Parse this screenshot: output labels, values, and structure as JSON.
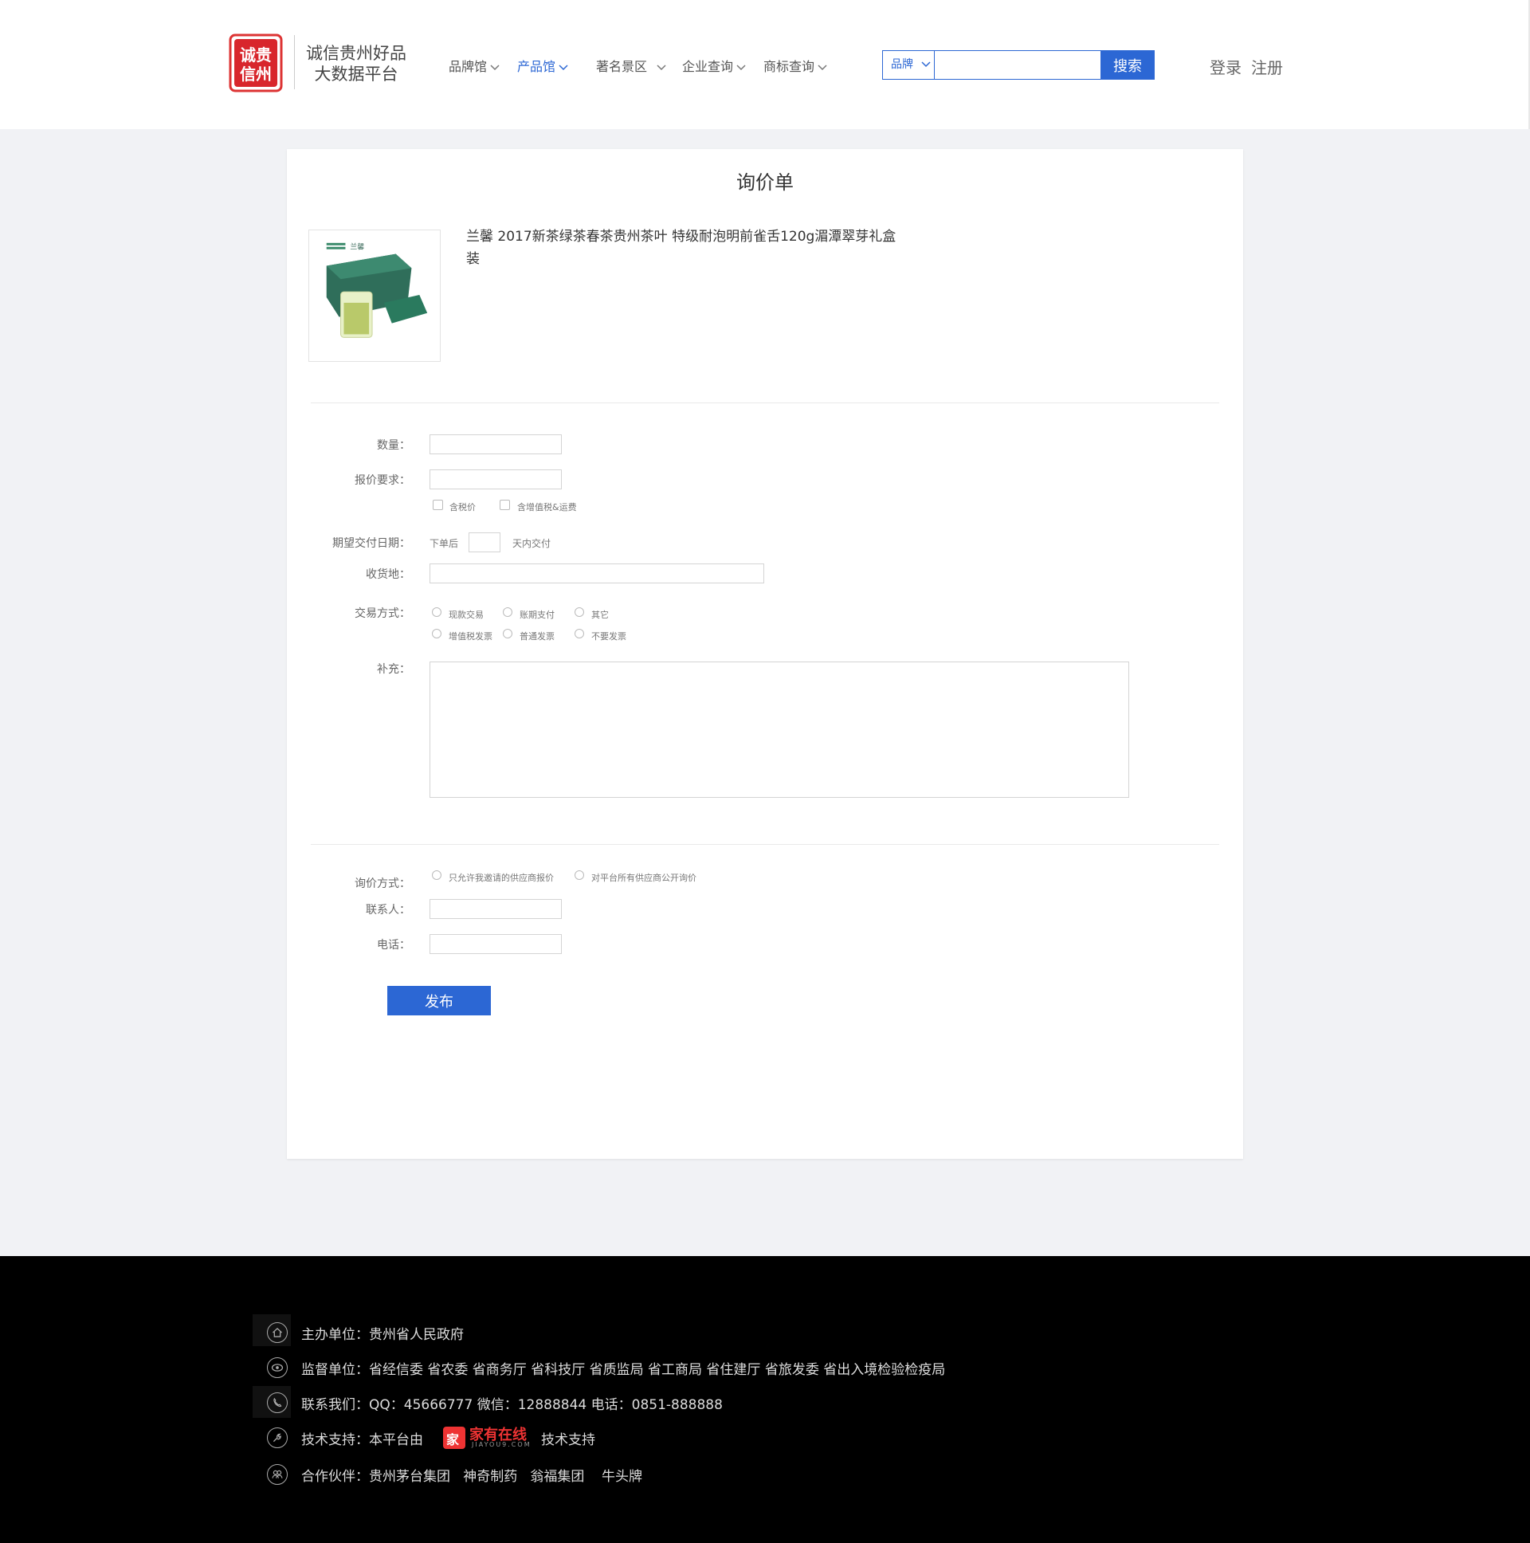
{
  "header": {
    "logo_line1": "诚信贵州好品",
    "logo_line2": "大数据平台",
    "nav": [
      {
        "label": "品牌馆",
        "active": false
      },
      {
        "label": "产品馆",
        "active": true
      },
      {
        "label": "著名景区",
        "active": false
      },
      {
        "label": "企业查询",
        "active": false
      },
      {
        "label": "商标查询",
        "active": false
      }
    ],
    "search": {
      "category": "品牌",
      "value": "",
      "button": "搜索"
    },
    "login": "登录",
    "register": "注册",
    "accent_color": "#2c67d4"
  },
  "form": {
    "title": "询价单",
    "product_name": "兰馨 2017新茶绿茶春茶贵州茶叶 特级耐泡明前雀舌120g湄潭翠芽礼盒装",
    "product_image_icon": "tea-gift-box-image",
    "quantity_label": "数量：",
    "quote_req_label": "报价要求：",
    "tax_included": "含税价",
    "tax_shipping_included": "含增值税&运费",
    "delivery_label": "期望交付日期：",
    "delivery_prefix": "下单后",
    "delivery_suffix": "天内交付",
    "address_label": "收货地：",
    "trade_label": "交易方式：",
    "trade_options": [
      "现款交易",
      "账期支付",
      "其它"
    ],
    "invoice_options": [
      "增值税发票",
      "普通发票",
      "不要发票"
    ],
    "extra_label": "补充：",
    "inquiry_label": "询价方式：",
    "inquiry_options": [
      "只允许我邀请的供应商报价",
      "对平台所有供应商公开询价"
    ],
    "contact_label": "联系人：",
    "phone_label": "电话：",
    "publish": "发布"
  },
  "footer": {
    "host": "主办单位：贵州省人民政府",
    "supervisor": "监督单位：省经信委 省农委 省商务厅 省科技厅 省质监局 省工商局 省住建厅 省旅发委 省出入境检验检疫局",
    "contact": "联系我们：QQ：45666777 微信：12888844 电话：0851-888888",
    "tech_prefix": "技术支持：本平台由",
    "tech_logo_mark": "家",
    "tech_logo_name": "家有在线",
    "tech_logo_sub": "JIAYOU9.COM",
    "tech_suffix": "技术支持",
    "partners": "合作伙伴：贵州茅台集团   神奇制药   翁福集团    牛头牌"
  }
}
